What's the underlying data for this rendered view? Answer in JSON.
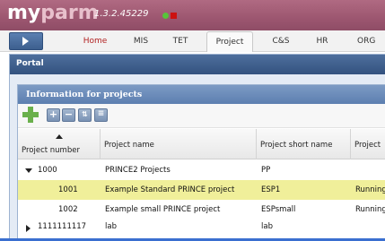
{
  "app": {
    "logo_my": "my",
    "logo_parm": "parm",
    "version": "1.3.2.45229"
  },
  "nav": {
    "tabs": [
      {
        "label": "Home"
      },
      {
        "label": "MIS"
      },
      {
        "label": "TET"
      },
      {
        "label": "Project"
      },
      {
        "label": "C&S"
      },
      {
        "label": "HR"
      },
      {
        "label": "ORG"
      }
    ],
    "selected": "Project",
    "active": "Home"
  },
  "portal": {
    "title": "Portal"
  },
  "panel": {
    "title": "Information for projects",
    "toolbar": {
      "add_icon": "add-icon",
      "expand_icon": "expand-all-icon",
      "collapse_icon": "collapse-all-icon",
      "move_icon": "move-icon",
      "indent_icon": "indent-icon"
    },
    "columns": {
      "project_number": "Project number",
      "project_name": "Project name",
      "project_short_name": "Project short name",
      "project_status": "Project"
    },
    "rows": [
      {
        "number": "1000",
        "name": "PRINCE2 Projects",
        "short": "PP",
        "status": ""
      },
      {
        "number": "1001",
        "name": "Example Standard PRINCE project",
        "short": "ESP1",
        "status": "Running"
      },
      {
        "number": "1002",
        "name": "Example small PRINCE project",
        "short": "ESPsmall",
        "status": "Running"
      },
      {
        "number": "1111111117",
        "name": "lab",
        "short": "lab",
        "status": ""
      }
    ]
  },
  "colors": {
    "header": "#9c5670",
    "portal_bar": "#33527f",
    "selected_row": "#f0ef9a",
    "active_tab": "#b22222"
  }
}
